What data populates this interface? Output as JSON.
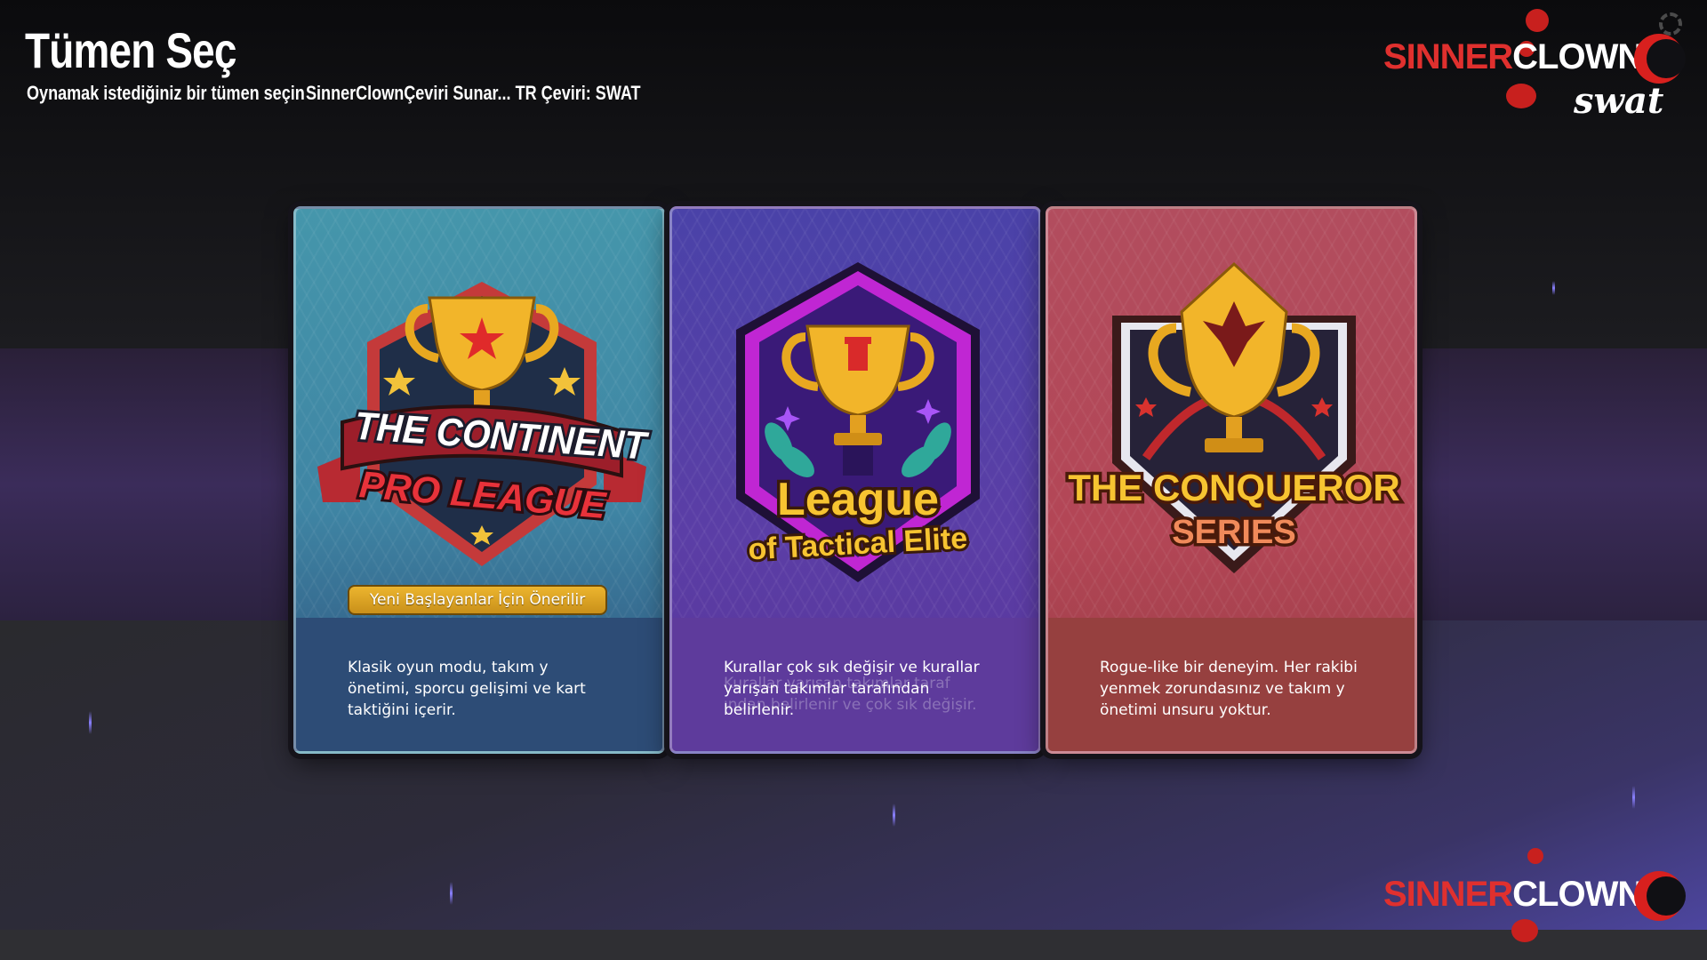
{
  "header": {
    "title": "Tümen Seç",
    "subtitle": "Oynamak istediğiniz bir tümen seçin",
    "credits": "SinnerClownÇeviri Sunar... TR Çeviri: SWAT"
  },
  "branding": {
    "top_logo_red": "SINNER",
    "top_logo_white": "CLOWN",
    "top_logo_tag": "swat",
    "bottom_logo_red": "SINNER",
    "bottom_logo_white": "CLOWN"
  },
  "divisions": [
    {
      "emblem_line1": "THE CONTINENT",
      "emblem_line2": "PRO LEAGUE",
      "badge": "Yeni Başlayanlar İçin Önerilir",
      "description": "Klasik oyun modu, takım y önetimi, sporcu gelişimi ve kart taktiğini içerir.",
      "color": "#4596ab"
    },
    {
      "emblem_line1": "League",
      "emblem_line2": "of Tactical Elite",
      "description": "Kurallar çok sık değişir ve kurallar yarışan takımlar tarafından belirlenir.",
      "ghost_text": "Kurallar yarışan takımlar taraf ından belirlenir ve çok sık değişir.",
      "color": "#5b3ea6"
    },
    {
      "emblem_line1": "THE CONQUEROR",
      "emblem_line2": "SERIES",
      "description": "Rogue-like bir deneyim. Her rakibi yenmek zorundasınız ve takım y önetimi unsuru yoktur.",
      "color": "#b34656"
    }
  ]
}
